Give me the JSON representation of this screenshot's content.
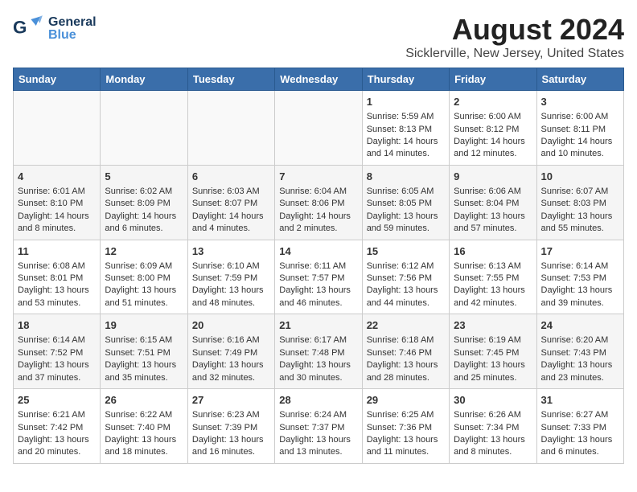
{
  "header": {
    "logo_general": "General",
    "logo_blue": "Blue",
    "main_title": "August 2024",
    "subtitle": "Sicklerville, New Jersey, United States"
  },
  "days_of_week": [
    "Sunday",
    "Monday",
    "Tuesday",
    "Wednesday",
    "Thursday",
    "Friday",
    "Saturday"
  ],
  "weeks": [
    [
      {
        "day": "",
        "info": ""
      },
      {
        "day": "",
        "info": ""
      },
      {
        "day": "",
        "info": ""
      },
      {
        "day": "",
        "info": ""
      },
      {
        "day": "1",
        "info": "Sunrise: 5:59 AM\nSunset: 8:13 PM\nDaylight: 14 hours and 14 minutes."
      },
      {
        "day": "2",
        "info": "Sunrise: 6:00 AM\nSunset: 8:12 PM\nDaylight: 14 hours and 12 minutes."
      },
      {
        "day": "3",
        "info": "Sunrise: 6:00 AM\nSunset: 8:11 PM\nDaylight: 14 hours and 10 minutes."
      }
    ],
    [
      {
        "day": "4",
        "info": "Sunrise: 6:01 AM\nSunset: 8:10 PM\nDaylight: 14 hours and 8 minutes."
      },
      {
        "day": "5",
        "info": "Sunrise: 6:02 AM\nSunset: 8:09 PM\nDaylight: 14 hours and 6 minutes."
      },
      {
        "day": "6",
        "info": "Sunrise: 6:03 AM\nSunset: 8:07 PM\nDaylight: 14 hours and 4 minutes."
      },
      {
        "day": "7",
        "info": "Sunrise: 6:04 AM\nSunset: 8:06 PM\nDaylight: 14 hours and 2 minutes."
      },
      {
        "day": "8",
        "info": "Sunrise: 6:05 AM\nSunset: 8:05 PM\nDaylight: 13 hours and 59 minutes."
      },
      {
        "day": "9",
        "info": "Sunrise: 6:06 AM\nSunset: 8:04 PM\nDaylight: 13 hours and 57 minutes."
      },
      {
        "day": "10",
        "info": "Sunrise: 6:07 AM\nSunset: 8:03 PM\nDaylight: 13 hours and 55 minutes."
      }
    ],
    [
      {
        "day": "11",
        "info": "Sunrise: 6:08 AM\nSunset: 8:01 PM\nDaylight: 13 hours and 53 minutes."
      },
      {
        "day": "12",
        "info": "Sunrise: 6:09 AM\nSunset: 8:00 PM\nDaylight: 13 hours and 51 minutes."
      },
      {
        "day": "13",
        "info": "Sunrise: 6:10 AM\nSunset: 7:59 PM\nDaylight: 13 hours and 48 minutes."
      },
      {
        "day": "14",
        "info": "Sunrise: 6:11 AM\nSunset: 7:57 PM\nDaylight: 13 hours and 46 minutes."
      },
      {
        "day": "15",
        "info": "Sunrise: 6:12 AM\nSunset: 7:56 PM\nDaylight: 13 hours and 44 minutes."
      },
      {
        "day": "16",
        "info": "Sunrise: 6:13 AM\nSunset: 7:55 PM\nDaylight: 13 hours and 42 minutes."
      },
      {
        "day": "17",
        "info": "Sunrise: 6:14 AM\nSunset: 7:53 PM\nDaylight: 13 hours and 39 minutes."
      }
    ],
    [
      {
        "day": "18",
        "info": "Sunrise: 6:14 AM\nSunset: 7:52 PM\nDaylight: 13 hours and 37 minutes."
      },
      {
        "day": "19",
        "info": "Sunrise: 6:15 AM\nSunset: 7:51 PM\nDaylight: 13 hours and 35 minutes."
      },
      {
        "day": "20",
        "info": "Sunrise: 6:16 AM\nSunset: 7:49 PM\nDaylight: 13 hours and 32 minutes."
      },
      {
        "day": "21",
        "info": "Sunrise: 6:17 AM\nSunset: 7:48 PM\nDaylight: 13 hours and 30 minutes."
      },
      {
        "day": "22",
        "info": "Sunrise: 6:18 AM\nSunset: 7:46 PM\nDaylight: 13 hours and 28 minutes."
      },
      {
        "day": "23",
        "info": "Sunrise: 6:19 AM\nSunset: 7:45 PM\nDaylight: 13 hours and 25 minutes."
      },
      {
        "day": "24",
        "info": "Sunrise: 6:20 AM\nSunset: 7:43 PM\nDaylight: 13 hours and 23 minutes."
      }
    ],
    [
      {
        "day": "25",
        "info": "Sunrise: 6:21 AM\nSunset: 7:42 PM\nDaylight: 13 hours and 20 minutes."
      },
      {
        "day": "26",
        "info": "Sunrise: 6:22 AM\nSunset: 7:40 PM\nDaylight: 13 hours and 18 minutes."
      },
      {
        "day": "27",
        "info": "Sunrise: 6:23 AM\nSunset: 7:39 PM\nDaylight: 13 hours and 16 minutes."
      },
      {
        "day": "28",
        "info": "Sunrise: 6:24 AM\nSunset: 7:37 PM\nDaylight: 13 hours and 13 minutes."
      },
      {
        "day": "29",
        "info": "Sunrise: 6:25 AM\nSunset: 7:36 PM\nDaylight: 13 hours and 11 minutes."
      },
      {
        "day": "30",
        "info": "Sunrise: 6:26 AM\nSunset: 7:34 PM\nDaylight: 13 hours and 8 minutes."
      },
      {
        "day": "31",
        "info": "Sunrise: 6:27 AM\nSunset: 7:33 PM\nDaylight: 13 hours and 6 minutes."
      }
    ]
  ]
}
